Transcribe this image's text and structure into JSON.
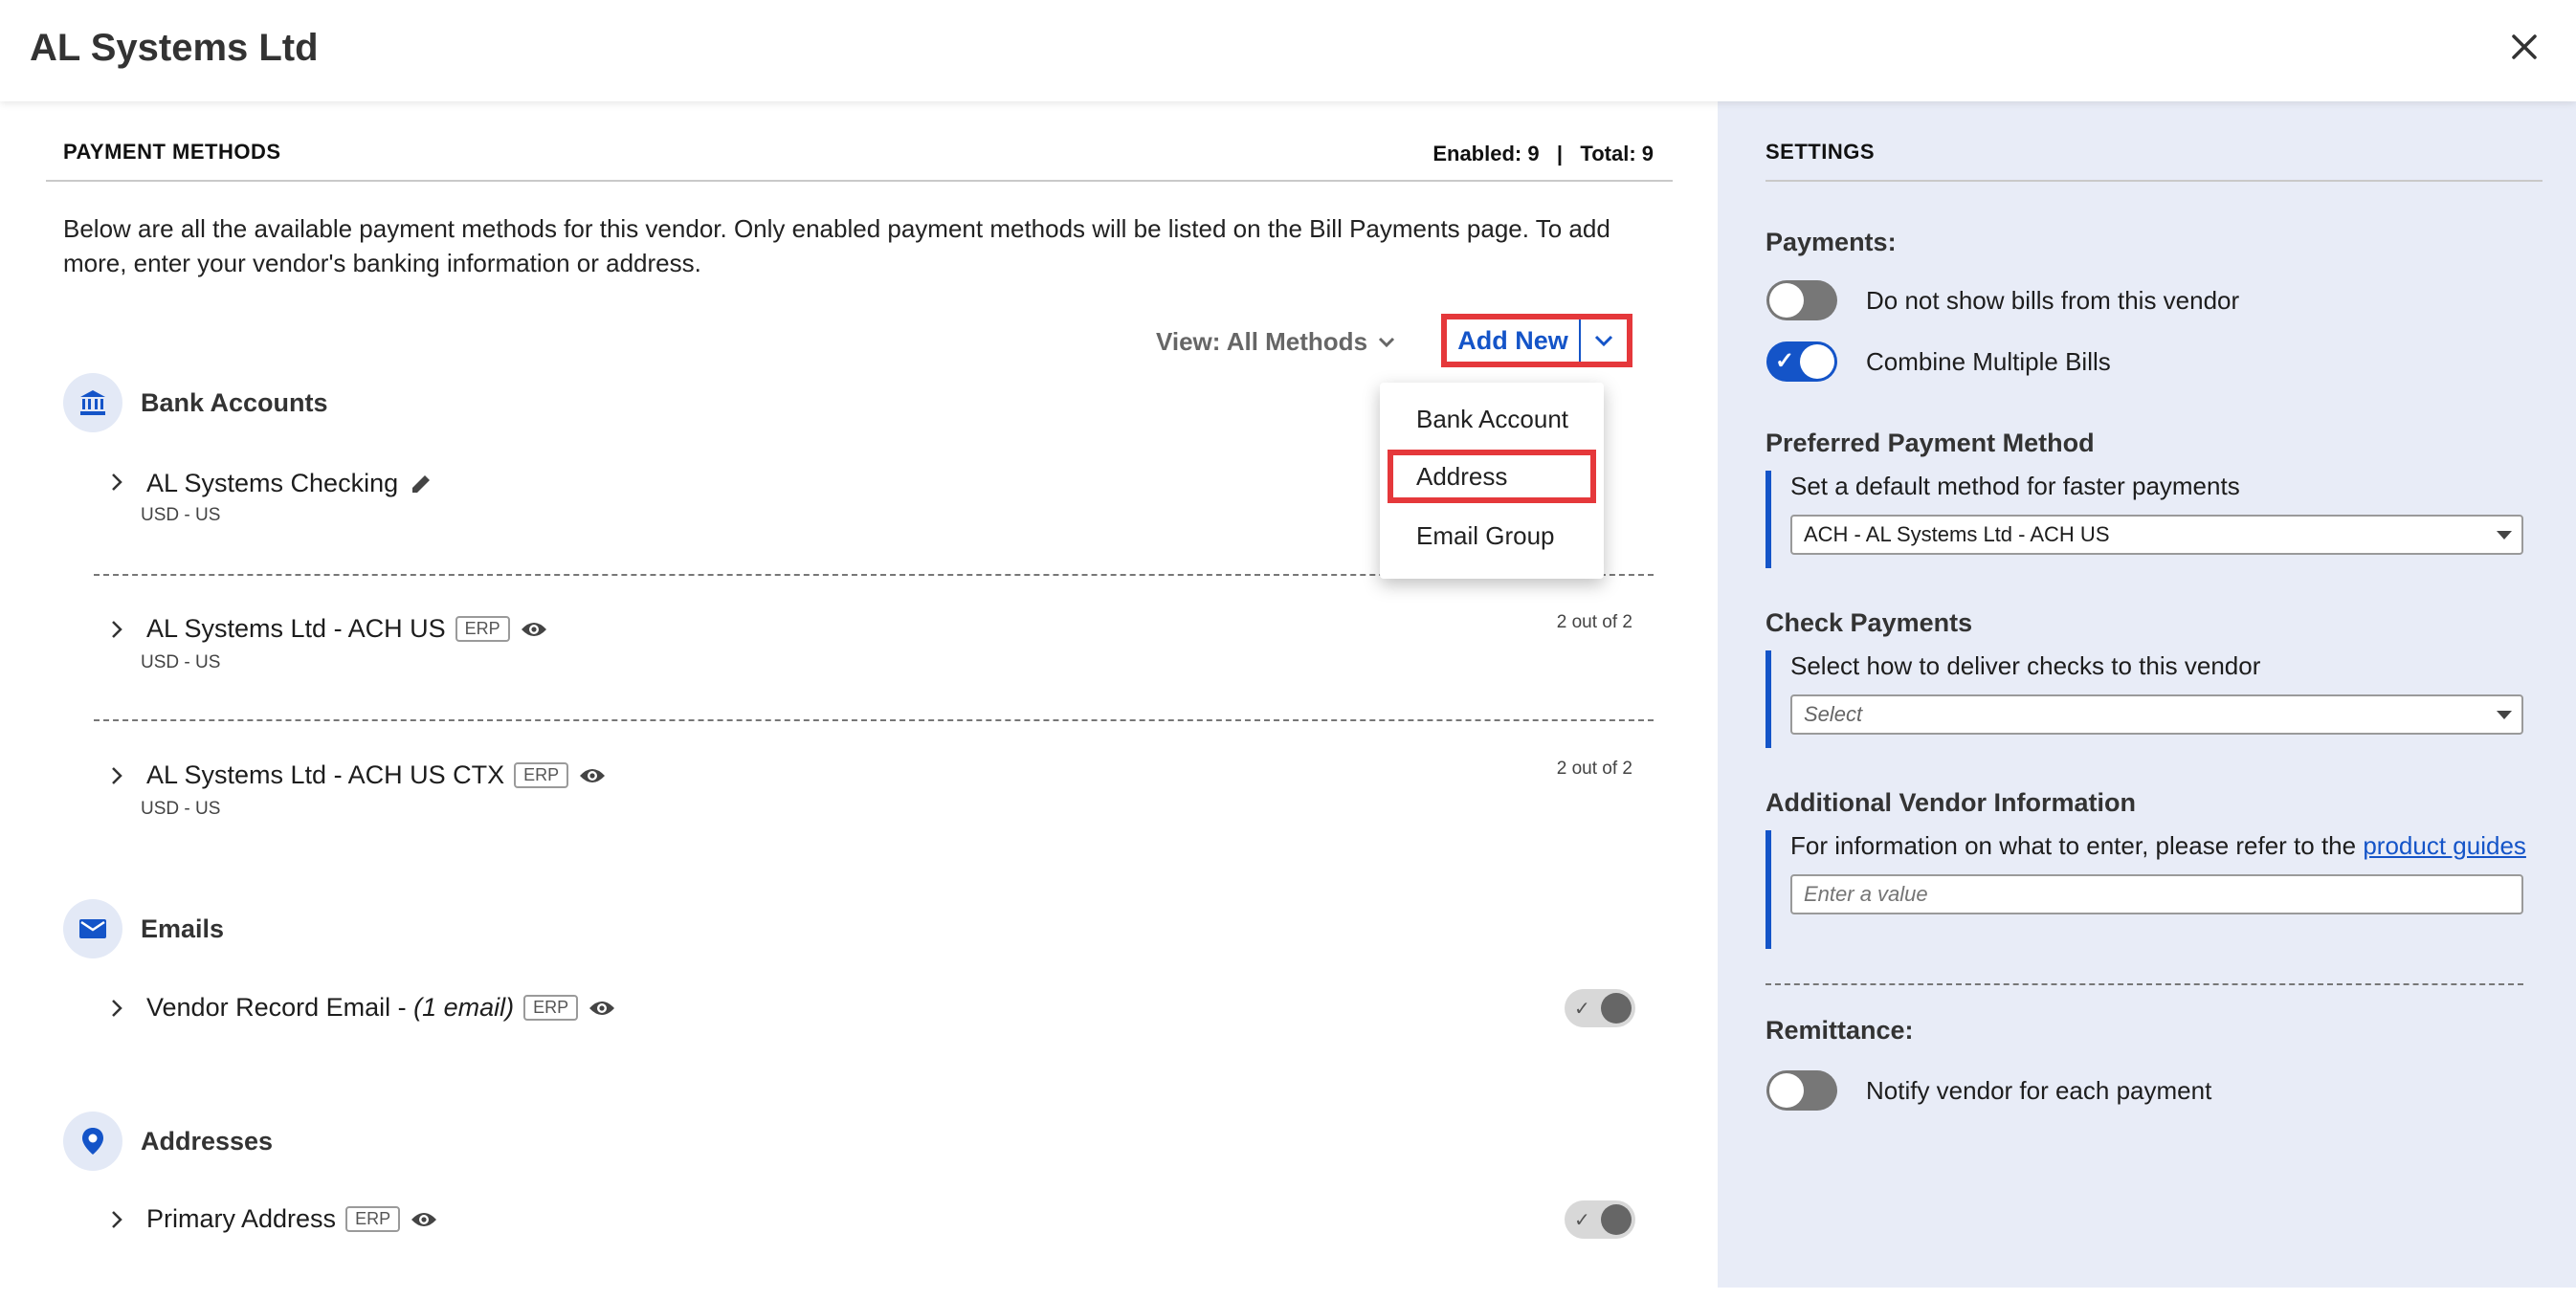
{
  "window": {
    "title": "AL Systems Ltd"
  },
  "payment_methods": {
    "heading": "PAYMENT METHODS",
    "counts": "Enabled: 9   |   Total: 9",
    "description": "Below are all the available payment methods for this vendor. Only enabled payment methods will be listed on the Bill Payments page. To add more, enter your vendor's banking information or address.",
    "view_filter": "View: All Methods",
    "add_new": "Add New",
    "dropdown": [
      "Bank Account",
      "Address",
      "Email Group"
    ],
    "groups": {
      "bank": {
        "title": "Bank Accounts",
        "rows": [
          {
            "name": "AL Systems Checking",
            "sub": "USD - US"
          },
          {
            "name": "AL Systems Ltd - ACH US",
            "badge": "ERP",
            "sub": "USD - US",
            "status": "2 out of 2"
          },
          {
            "name": "AL Systems Ltd - ACH US CTX",
            "badge": "ERP",
            "sub": "USD - US",
            "status": "2 out of 2"
          }
        ]
      },
      "emails": {
        "title": "Emails",
        "rows": [
          {
            "name_prefix": "Vendor Record Email - ",
            "name_italic": "(1 email)",
            "badge": "ERP",
            "enabled": true
          }
        ]
      },
      "addresses": {
        "title": "Addresses",
        "rows": [
          {
            "name": "Primary Address",
            "badge": "ERP",
            "enabled": true
          }
        ]
      }
    }
  },
  "settings": {
    "heading": "SETTINGS",
    "payments_label": "Payments:",
    "toggles": [
      {
        "label": "Do not show bills from this vendor",
        "on": false
      },
      {
        "label": "Combine Multiple Bills",
        "on": true
      }
    ],
    "preferred": {
      "label": "Preferred Payment Method",
      "help": "Set a default method for faster payments",
      "value": "ACH - AL Systems Ltd - ACH US"
    },
    "check": {
      "label": "Check Payments",
      "help": "Select how to deliver checks to this vendor",
      "value": "Select"
    },
    "additional": {
      "label": "Additional Vendor Information",
      "help_prefix": "For information on what to enter, please refer to the ",
      "help_link": "product guides",
      "placeholder": "Enter a value"
    },
    "remittance": {
      "label": "Remittance:",
      "toggle_label": "Notify vendor for each payment",
      "on": false
    }
  },
  "colors": {
    "accent": "#1454c8",
    "highlight": "#e5383b",
    "settings_bg": "#e8ecf7"
  },
  "icons": [
    "close-icon",
    "bank-icon",
    "pencil-icon",
    "eye-icon",
    "chevron-right-icon",
    "chevron-down-icon",
    "mail-icon",
    "location-pin-icon",
    "check-icon"
  ]
}
